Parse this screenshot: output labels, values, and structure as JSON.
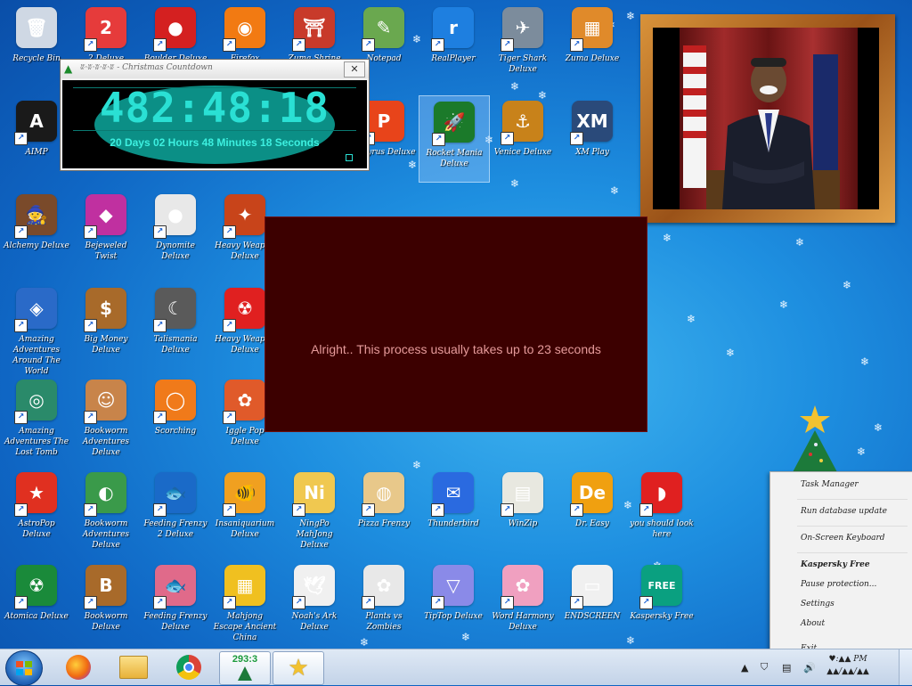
{
  "countdown": {
    "title": "ʬ·ʬ·ʬ·ʬ·ʬ - Christmas Countdown",
    "clock": "482:48:18",
    "subtitle": "20 Days 02 Hours 48 Minutes 18 Seconds",
    "close": "✕",
    "tree_icon": "christmas-tree-icon"
  },
  "dialog": {
    "message": "Alright.. This process usually takes up to 23 seconds"
  },
  "icons": [
    {
      "label": "Recycle Bin",
      "color": "#cfd8e4",
      "glyph": "🗑",
      "name": "recycle-bin-icon"
    },
    {
      "label": "2 Deluxe",
      "color": "#e63b3b",
      "glyph": "2",
      "name": "app-icon"
    },
    {
      "label": "Boulder Deluxe",
      "color": "#d42020",
      "glyph": "●",
      "name": "app-icon"
    },
    {
      "label": "Firefox",
      "color": "#f27a12",
      "glyph": "◉",
      "name": "firefox-icon"
    },
    {
      "label": "Zuma Shrine",
      "color": "#c83a2a",
      "glyph": "⛩",
      "name": "app-icon"
    },
    {
      "label": "Notepad",
      "color": "#6aa84f",
      "glyph": "✎",
      "name": "notepad-icon"
    },
    {
      "label": "RealPlayer",
      "color": "#1e7fe0",
      "glyph": "r",
      "name": "app-icon"
    },
    {
      "label": "Tiger Shark Deluxe",
      "color": "#7c8c9c",
      "glyph": "✈",
      "name": "app-icon"
    },
    {
      "label": "Zuma Deluxe",
      "color": "#e08a2a",
      "glyph": "▦",
      "name": "app-icon"
    },
    {
      "label": "AIMP",
      "color": "#1a1a1a",
      "glyph": "A",
      "name": "app-icon"
    },
    {
      "label": "Papyrus Deluxe",
      "color": "#e8441a",
      "glyph": "P",
      "name": "app-icon"
    },
    {
      "label": "Rocket Mania Deluxe",
      "color": "#1b7a2a",
      "glyph": "🚀",
      "name": "app-icon"
    },
    {
      "label": "Venice Deluxe",
      "color": "#c8821a",
      "glyph": "⚓",
      "name": "app-icon"
    },
    {
      "label": "XM Play",
      "color": "#2a4a7a",
      "glyph": "XM",
      "name": "app-icon"
    },
    {
      "label": "Alchemy Deluxe",
      "color": "#7a4a2a",
      "glyph": "🧙",
      "name": "app-icon"
    },
    {
      "label": "Bejeweled Twist",
      "color": "#c030a0",
      "glyph": "◆",
      "name": "app-icon"
    },
    {
      "label": "Dynomite Deluxe",
      "color": "#e8e8e8",
      "glyph": "●",
      "name": "app-icon"
    },
    {
      "label": "Heavy Weapon Deluxe",
      "color": "#c8441a",
      "glyph": "✦",
      "name": "app-icon"
    },
    {
      "label": "Amazing Adventures Around The World",
      "color": "#2a6ac8",
      "glyph": "◈",
      "name": "app-icon"
    },
    {
      "label": "Big Money Deluxe",
      "color": "#a86a2a",
      "glyph": "$",
      "name": "app-icon"
    },
    {
      "label": "Talismania Deluxe",
      "color": "#5a5a5a",
      "glyph": "☾",
      "name": "app-icon"
    },
    {
      "label": "Heavy Weapon Deluxe",
      "color": "#e02020",
      "glyph": "☢",
      "name": "app-icon"
    },
    {
      "label": "Amazing Adventures The Lost Tomb",
      "color": "#2a8a6a",
      "glyph": "◎",
      "name": "app-icon"
    },
    {
      "label": "Bookworm Adventures Deluxe",
      "color": "#c8844a",
      "glyph": "☺",
      "name": "app-icon"
    },
    {
      "label": "Scorching",
      "color": "#f07a1a",
      "glyph": "◯",
      "name": "app-icon"
    },
    {
      "label": "Iggle Pop Deluxe",
      "color": "#e05a2a",
      "glyph": "✿",
      "name": "app-icon"
    },
    {
      "label": "AstroPop Deluxe",
      "color": "#e03020",
      "glyph": "★",
      "name": "app-icon"
    },
    {
      "label": "Bookworm Adventures Deluxe",
      "color": "#3a9a4a",
      "glyph": "◐",
      "name": "app-icon"
    },
    {
      "label": "Feeding Frenzy 2 Deluxe",
      "color": "#1a6ac8",
      "glyph": "🐟",
      "name": "app-icon"
    },
    {
      "label": "Insaniquarium Deluxe",
      "color": "#f0a020",
      "glyph": "🐠",
      "name": "app-icon"
    },
    {
      "label": "NingPo MahJong Deluxe",
      "color": "#f0c850",
      "glyph": "Ni",
      "name": "app-icon"
    },
    {
      "label": "Pizza Frenzy",
      "color": "#e8c88a",
      "glyph": "◍",
      "name": "app-icon"
    },
    {
      "label": "Thunderbird",
      "color": "#2a6ae0",
      "glyph": "✉",
      "name": "thunderbird-icon"
    },
    {
      "label": "WinZip",
      "color": "#e8e8e0",
      "glyph": "▤",
      "name": "app-icon"
    },
    {
      "label": "Dr. Easy",
      "color": "#f0a010",
      "glyph": "De",
      "name": "app-icon"
    },
    {
      "label": "you should look here",
      "color": "#e02020",
      "glyph": "◗",
      "name": "app-icon"
    },
    {
      "label": "Atomica Deluxe",
      "color": "#1a8a3a",
      "glyph": "☢",
      "name": "app-icon"
    },
    {
      "label": "Bookworm Deluxe",
      "color": "#a86a2a",
      "glyph": "B",
      "name": "app-icon"
    },
    {
      "label": "Feeding Frenzy Deluxe",
      "color": "#e06a8a",
      "glyph": "🐟",
      "name": "app-icon"
    },
    {
      "label": "Mahjong Escape Ancient China",
      "color": "#f0c020",
      "glyph": "▦",
      "name": "app-icon"
    },
    {
      "label": "Noah's Ark Deluxe",
      "color": "#f0f0f0",
      "glyph": "🕊",
      "name": "app-icon"
    },
    {
      "label": "Plants vs Zombies",
      "color": "#e8e8e8",
      "glyph": "✿",
      "name": "app-icon"
    },
    {
      "label": "TipTop Deluxe",
      "color": "#8a8ae8",
      "glyph": "▽",
      "name": "app-icon"
    },
    {
      "label": "Word Harmony Deluxe",
      "color": "#f0a0c0",
      "glyph": "✿",
      "name": "app-icon"
    },
    {
      "label": "ENDSCREEN",
      "color": "#f0f0f0",
      "glyph": "▭",
      "name": "app-icon"
    },
    {
      "label": "Kaspersky Free",
      "color": "#0aa080",
      "glyph": "FREE",
      "name": "kaspersky-icon"
    }
  ],
  "ctxmenu": {
    "items": [
      {
        "label": "Task Manager",
        "bold": false
      },
      {
        "label": "Run database update",
        "bold": false
      },
      {
        "label": "On-Screen Keyboard",
        "bold": false
      },
      {
        "label": "Kaspersky Free",
        "bold": true
      },
      {
        "label": "Pause protection...",
        "bold": false
      },
      {
        "label": "Settings",
        "bold": false
      },
      {
        "label": "About",
        "bold": false
      },
      {
        "label": "Exit",
        "bold": false
      }
    ]
  },
  "taskbar": {
    "counter": "293:3",
    "clock_line1": "♥:▲▲ PM",
    "clock_line2": "▲▲/▲▲/▲▲"
  },
  "colors": {
    "dialog_bg": "#3c0000",
    "dialog_text": "#e59a9a",
    "clock_text": "#2ae0d4",
    "desktop": "#1e8fe0"
  }
}
